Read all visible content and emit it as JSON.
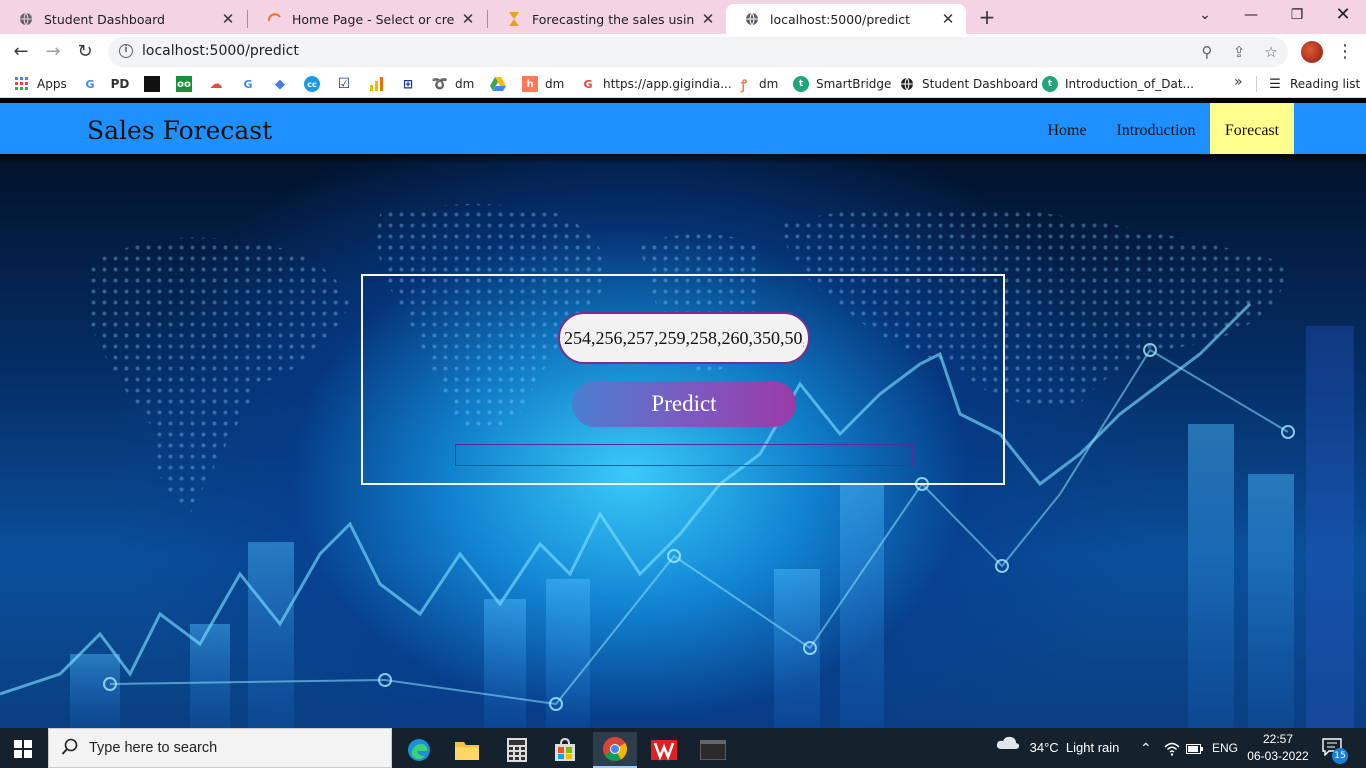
{
  "browser": {
    "tabs": [
      {
        "title": "Student Dashboard",
        "icon": "globe-icon",
        "active": false
      },
      {
        "title": "Home Page - Select or create a n",
        "icon": "loading-icon",
        "active": false
      },
      {
        "title": "Forecasting the sales using LSTM",
        "icon": "hourglass-icon",
        "active": false
      },
      {
        "title": "localhost:5000/predict",
        "icon": "globe-icon",
        "active": true
      }
    ],
    "url": "localhost:5000/predict",
    "bookmarks": [
      {
        "label": "Apps",
        "icon": "apps-grid-icon"
      },
      {
        "label": "",
        "icon": "google-icon"
      },
      {
        "label": "",
        "icon": "pd-icon"
      },
      {
        "label": "",
        "icon": "black-square-icon"
      },
      {
        "label": "",
        "icon": "infinity-icon"
      },
      {
        "label": "",
        "icon": "cloud-icon"
      },
      {
        "label": "",
        "icon": "google-icon"
      },
      {
        "label": "",
        "icon": "diamond-icon"
      },
      {
        "label": "",
        "icon": "cc-icon"
      },
      {
        "label": "",
        "icon": "checkbox-icon"
      },
      {
        "label": "",
        "icon": "bar-chart-icon"
      },
      {
        "label": "",
        "icon": "map-icon"
      },
      {
        "label": "dm",
        "icon": "swirl-icon"
      },
      {
        "label": "",
        "icon": "drive-icon"
      },
      {
        "label": "dm",
        "icon": "hubspot-icon"
      },
      {
        "label": "https://app.gigindia...",
        "icon": "g-icon"
      },
      {
        "label": "dm",
        "icon": "hubspot-icon"
      },
      {
        "label": "SmartBridge",
        "icon": "smartbridge-icon"
      },
      {
        "label": "Student Dashboard",
        "icon": "globe-icon"
      },
      {
        "label": "Introduction_of_Dat...",
        "icon": "smartbridge-icon"
      }
    ],
    "reading_list": "Reading list",
    "more_bookmarks": "»"
  },
  "site": {
    "title": "Sales Forecast",
    "nav": [
      {
        "label": "Home",
        "active": false
      },
      {
        "label": "Introduction",
        "active": false
      },
      {
        "label": "Forecast",
        "active": true
      }
    ],
    "form": {
      "input_value": "254,256,257,259,258,260,350,50,",
      "button_label": "Predict",
      "result_text": ""
    }
  },
  "taskbar": {
    "search_placeholder": "Type here to search",
    "apps": [
      "edge-icon",
      "file-explorer-icon",
      "calculator-icon",
      "store-icon",
      "chrome-icon",
      "vlc-icon",
      "terminal-icon"
    ],
    "weather": "34°C  Light rain",
    "language": "ENG",
    "time": "22:57",
    "date": "06-03-2022",
    "notification_count": "15"
  },
  "colors": {
    "site_nav": "#1e90ff",
    "active_nav": "#ffff8c",
    "tab_strip": "#f3d3e4"
  }
}
